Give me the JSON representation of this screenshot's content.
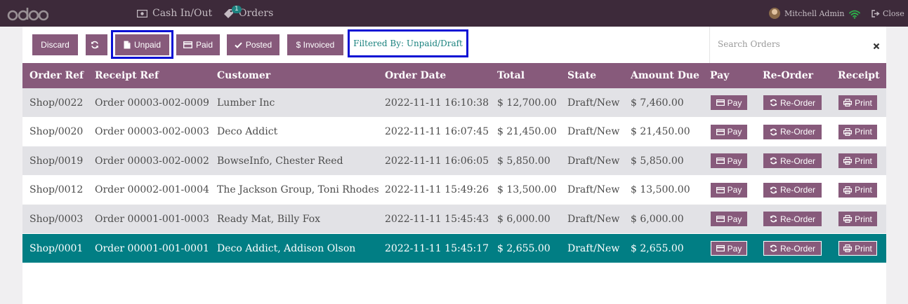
{
  "topbar": {
    "logo": "odoo",
    "cash_label": "Cash In/Out",
    "orders_label": "Orders",
    "orders_badge": "1",
    "user_name": "Mitchell Admin",
    "close_label": "Close"
  },
  "controls": {
    "discard": "Discard",
    "unpaid": "Unpaid",
    "paid": "Paid",
    "posted": "Posted",
    "invoiced": "$ Invoiced",
    "filter_text": "Filtered By: Unpaid/Draft"
  },
  "search": {
    "placeholder": "Search Orders"
  },
  "table": {
    "headers": {
      "order_ref": "Order Ref",
      "receipt_ref": "Receipt Ref",
      "customer": "Customer",
      "order_date": "Order Date",
      "total": "Total",
      "state": "State",
      "amount_due": "Amount Due",
      "pay": "Pay",
      "reorder": "Re-Order",
      "receipt": "Receipt"
    },
    "button_labels": {
      "pay": "Pay",
      "reorder": "Re-Order",
      "print": "Print"
    },
    "rows": [
      {
        "order_ref": "Shop/0022",
        "receipt_ref": "Order 00003-002-0009",
        "customer": "Lumber Inc",
        "order_date": "2022-11-11 16:10:38",
        "total": "$ 12,700.00",
        "state": "Draft/New",
        "amount_due": "$ 7,460.00"
      },
      {
        "order_ref": "Shop/0020",
        "receipt_ref": "Order 00003-002-0003",
        "customer": "Deco Addict",
        "order_date": "2022-11-11 16:07:45",
        "total": "$ 21,450.00",
        "state": "Draft/New",
        "amount_due": "$ 21,450.00"
      },
      {
        "order_ref": "Shop/0019",
        "receipt_ref": "Order 00003-002-0002",
        "customer": "BowseInfo, Chester Reed",
        "order_date": "2022-11-11 16:06:05",
        "total": "$ 5,850.00",
        "state": "Draft/New",
        "amount_due": "$ 5,850.00"
      },
      {
        "order_ref": "Shop/0012",
        "receipt_ref": "Order 00002-001-0004",
        "customer": "The Jackson Group, Toni Rhodes",
        "order_date": "2022-11-11 15:49:26",
        "total": "$ 13,500.00",
        "state": "Draft/New",
        "amount_due": "$ 13,500.00"
      },
      {
        "order_ref": "Shop/0003",
        "receipt_ref": "Order 00001-001-0003",
        "customer": "Ready Mat, Billy Fox",
        "order_date": "2022-11-11 15:45:43",
        "total": "$ 6,000.00",
        "state": "Draft/New",
        "amount_due": "$ 6,000.00"
      },
      {
        "order_ref": "Shop/0001",
        "receipt_ref": "Order 00001-001-0001",
        "customer": "Deco Addict, Addison Olson",
        "order_date": "2022-11-11 15:45:17",
        "total": "$ 2,655.00",
        "state": "Draft/New",
        "amount_due": "$ 2,655.00"
      }
    ],
    "selected_row": 5
  },
  "colors": {
    "topbar": "#3d2a3a",
    "brand": "#875a7b",
    "selected_row": "#017e84",
    "highlight_outline": "#0a10d4"
  }
}
